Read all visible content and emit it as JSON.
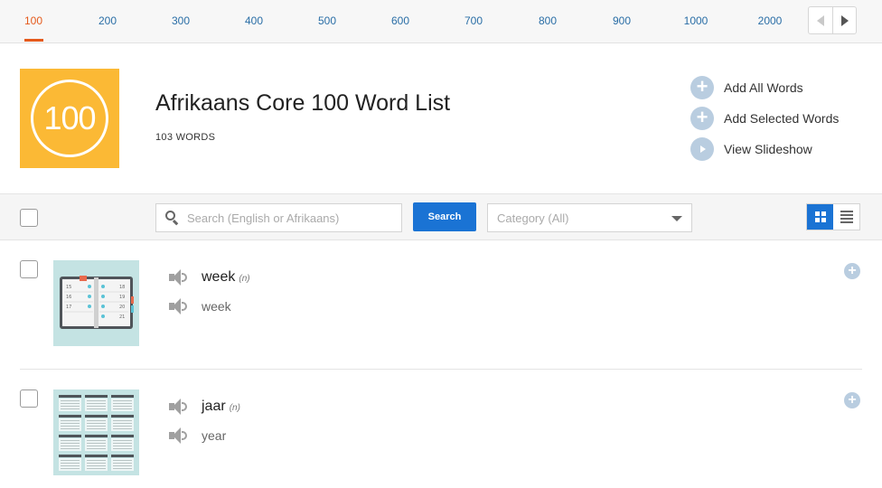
{
  "levels": {
    "tabs": [
      "100",
      "200",
      "300",
      "400",
      "500",
      "600",
      "700",
      "800",
      "900",
      "1000",
      "2000"
    ],
    "active": "100",
    "pager": {
      "prev_icon": "triangle-left-icon",
      "next_icon": "triangle-right-icon"
    }
  },
  "header": {
    "badge_text": "100",
    "title": "Afrikaans Core 100 Word List",
    "word_count": "103 WORDS",
    "actions": {
      "add_all": "Add All Words",
      "add_selected": "Add Selected Words",
      "view_slideshow": "View Slideshow"
    }
  },
  "toolbar": {
    "search_placeholder": "Search (English or Afrikaans)",
    "search_button": "Search",
    "category_value": "Category (All)",
    "view_mode": "grid"
  },
  "words": [
    {
      "target": "week",
      "pos": "(n)",
      "translation": "week",
      "image": "calendar-planner"
    },
    {
      "target": "jaar",
      "pos": "(n)",
      "translation": "year",
      "image": "year-calendar"
    }
  ],
  "colors": {
    "accent_orange": "#e55a1c",
    "badge_yellow": "#fbb935",
    "primary_blue": "#1a73d4",
    "link_blue": "#2a6ea6",
    "soft_blue": "#b9cde0"
  }
}
